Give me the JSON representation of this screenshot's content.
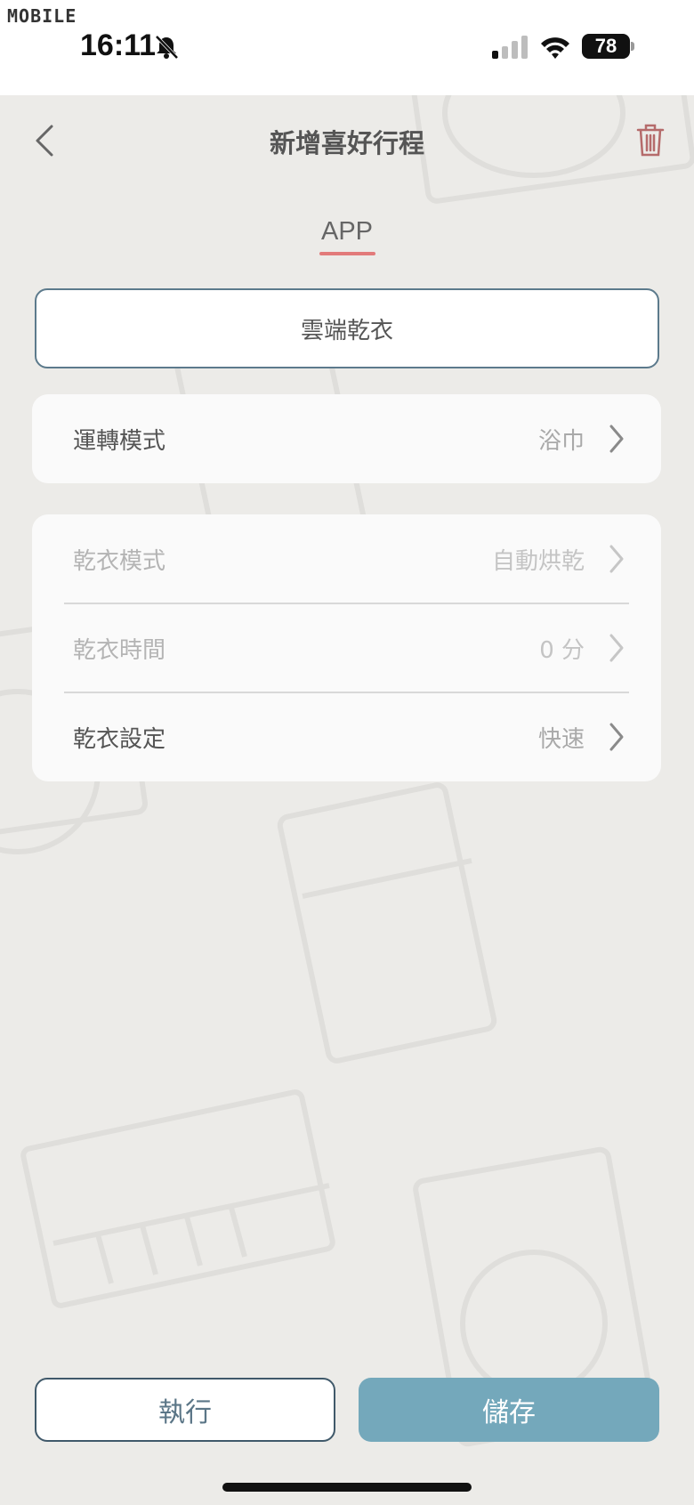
{
  "status_bar": {
    "watermark": "MOBILE",
    "time": "16:11",
    "battery": "78"
  },
  "header": {
    "title": "新增喜好行程"
  },
  "tabs": [
    {
      "label": "APP",
      "active": true
    }
  ],
  "schedule_name": "雲端乾衣",
  "operation_card": {
    "rows": [
      {
        "label": "運轉模式",
        "value": "浴巾"
      }
    ]
  },
  "dry_card": {
    "rows": [
      {
        "label": "乾衣模式",
        "value": "自動烘乾",
        "disabled": true
      },
      {
        "label": "乾衣時間",
        "value": "0 分",
        "disabled": true
      },
      {
        "label": "乾衣設定",
        "value": "快速",
        "disabled": false
      }
    ]
  },
  "footer": {
    "run_label": "執行",
    "save_label": "儲存"
  },
  "colors": {
    "accent_underline": "#e27a7a",
    "save_button": "#74a8bb",
    "trash_icon": "#b56b6b",
    "background": "#ecebe8"
  },
  "icons": [
    "back-arrow-icon",
    "trash-icon",
    "chevron-right-icon",
    "bell-off-icon",
    "signal-icon",
    "wifi-icon"
  ]
}
